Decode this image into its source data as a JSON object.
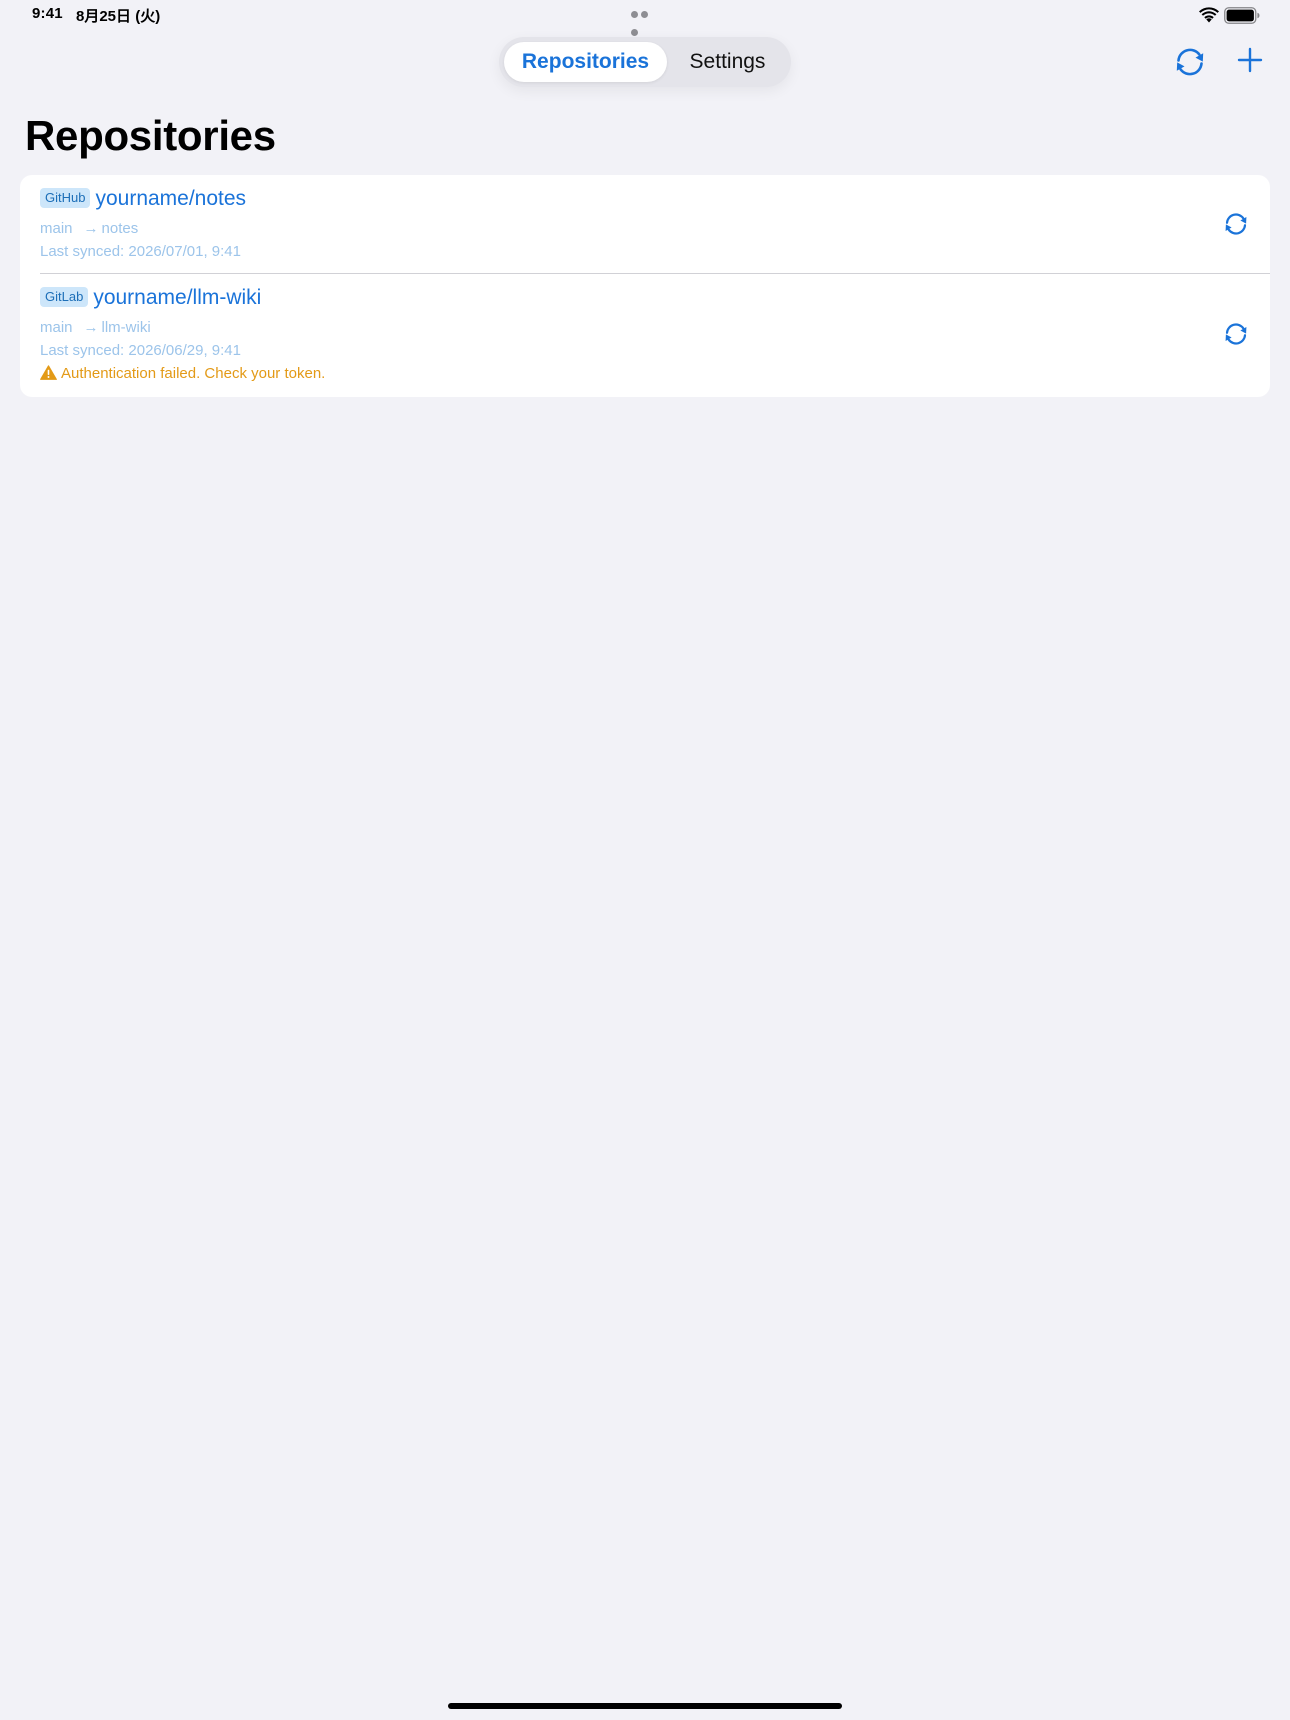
{
  "status_bar": {
    "time": "9:41",
    "date": "8月25日 (火)"
  },
  "nav": {
    "tabs": [
      {
        "label": "Repositories",
        "selected": true
      },
      {
        "label": "Settings",
        "selected": false
      }
    ],
    "sync_icon": "sync-icon",
    "add_icon": "plus-icon"
  },
  "page": {
    "title": "Repositories"
  },
  "repositories": [
    {
      "provider": "GitHub",
      "name": "yourname/notes",
      "branch": "main",
      "arrow": "→",
      "target": "notes",
      "last_synced": "Last synced: 2026/07/01, 9:41",
      "error": null
    },
    {
      "provider": "GitLab",
      "name": "yourname/llm-wiki",
      "branch": "main",
      "arrow": "→",
      "target": "llm-wiki",
      "last_synced": "Last synced: 2026/06/29, 9:41",
      "error": "Authentication failed. Check your token."
    }
  ],
  "colors": {
    "accent": "#1a73d9",
    "background": "#f2f2f7",
    "card": "#ffffff",
    "badge_bg": "#cde6fa",
    "meta_text": "#9cc4ea",
    "warning": "#e39a17"
  }
}
